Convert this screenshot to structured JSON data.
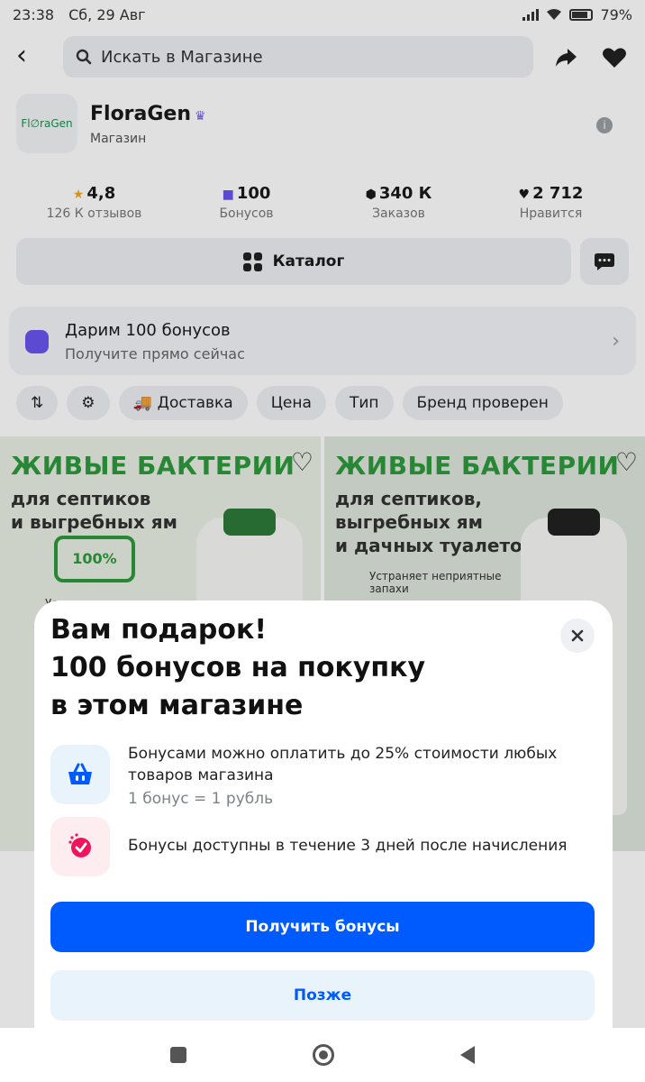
{
  "statusbar": {
    "time": "23:38",
    "date": "Сб, 29 Авг",
    "battery": "79%"
  },
  "search": {
    "placeholder": "Искать в Магазине"
  },
  "shop": {
    "logo_text": "Fl∅raGen",
    "name": "FloraGen",
    "type": "Магазин"
  },
  "stats": [
    {
      "icon": "star-icon",
      "value": "4,8",
      "label": "126 К отзывов"
    },
    {
      "icon": "gift-icon",
      "value": "100",
      "label": "Бонусов"
    },
    {
      "icon": "box-icon",
      "value": "340 К",
      "label": "Заказов"
    },
    {
      "icon": "heart-icon",
      "value": "2 712",
      "label": "Нравится"
    }
  ],
  "catalog_label": "Каталог",
  "bonus_banner": {
    "title": "Дарим 100 бонусов",
    "subtitle": "Получите прямо сейчас"
  },
  "filters": [
    "Доставка",
    "Цена",
    "Тип",
    "Бренд проверен"
  ],
  "products": [
    {
      "headline": "ЖИВЫЕ БАКТЕРИИ",
      "sub": "для септиков\nи выгребных ям",
      "badge": "100%",
      "note": "Устраняет неприятные"
    },
    {
      "headline": "ЖИВЫЕ БАКТЕРИИ",
      "sub": "для септиков,\nвыгребных ям\nи дачных туалетов",
      "note": "Устраняет неприятные\nзапахи"
    }
  ],
  "modal": {
    "title_lines": [
      "Вам подарок!",
      "100 бонусов на покупку",
      "в этом магазине"
    ],
    "feature1_text": "Бонусами можно оплатить до 25% стоимости любых товаров магазина",
    "feature1_note": "1 бонус = 1 рубль",
    "feature2_text": "Бонусы доступны в течение 3 дней после начисления",
    "primary_button": "Получить бонусы",
    "secondary_button": "Позже"
  },
  "colors": {
    "accent": "#005bff",
    "accent_light": "#e8f3fb",
    "pink_light": "#fdecf0",
    "brand_green": "#2e9a3d"
  }
}
